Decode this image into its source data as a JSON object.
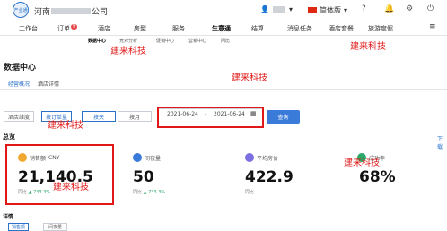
{
  "header": {
    "company_prefix": "河南",
    "company_suffix": "公司",
    "logo_text": "产业通",
    "user_icon": "user-icon",
    "language": "简体版",
    "icons": [
      "help-icon",
      "bell-icon",
      "settings-icon",
      "logout-icon"
    ]
  },
  "nav": {
    "items": [
      {
        "label": "工作台"
      },
      {
        "label": "订单",
        "badge": "9"
      },
      {
        "label": "酒店"
      },
      {
        "label": "房型"
      },
      {
        "label": "服务"
      },
      {
        "label": "生意通"
      },
      {
        "label": "结算"
      },
      {
        "label": "消息任务"
      },
      {
        "label": "酒店套餐"
      },
      {
        "label": "旅游度假"
      }
    ],
    "menu_icon": "hamburger-icon"
  },
  "subnav": {
    "items": [
      {
        "label": "数据中心"
      },
      {
        "label": "竞对分析"
      },
      {
        "label": "促销中心"
      },
      {
        "label": "营销中心"
      },
      {
        "label": "问比"
      }
    ]
  },
  "page": {
    "title": "数据中心",
    "tabs": [
      "经营概况",
      "酒店详情"
    ]
  },
  "filters": {
    "dimension_buttons": [
      "酒店维度",
      "按订单量"
    ],
    "period_buttons": [
      "按天",
      "按月"
    ],
    "start_date": "2021-06-24",
    "date_separator": "-",
    "end_date": "2021-06-24",
    "calendar_icon": "calendar-icon",
    "query_label": "查询"
  },
  "overview": {
    "section_label": "总览",
    "download_label": "下载",
    "cards": [
      {
        "label": "销售额",
        "unit": "CNY",
        "value": "21,140.5",
        "compare_label": "同比",
        "change": "733.3%",
        "icon": "sales-icon",
        "color": "#f0a830"
      },
      {
        "label": "间夜量",
        "value": "50",
        "compare_label": "同比",
        "change": "733.3%",
        "icon": "room-nights-icon",
        "color": "#3a7ad9"
      },
      {
        "label": "平均房价",
        "value": "422.9",
        "compare_label": "同比",
        "change": "",
        "icon": "avg-price-icon",
        "color": "#7a6ee0"
      },
      {
        "label": "成功率",
        "value": "68%",
        "compare_label": "",
        "change": "",
        "icon": "success-rate-icon",
        "color": "#2aa86a"
      }
    ]
  },
  "details": {
    "section_label": "详情",
    "tabs": [
      "销售额",
      "间夜量"
    ]
  },
  "watermarks": [
    "建来科技",
    "建来科技",
    "建来科技",
    "建来科技",
    "建来科技",
    "建来科技"
  ]
}
